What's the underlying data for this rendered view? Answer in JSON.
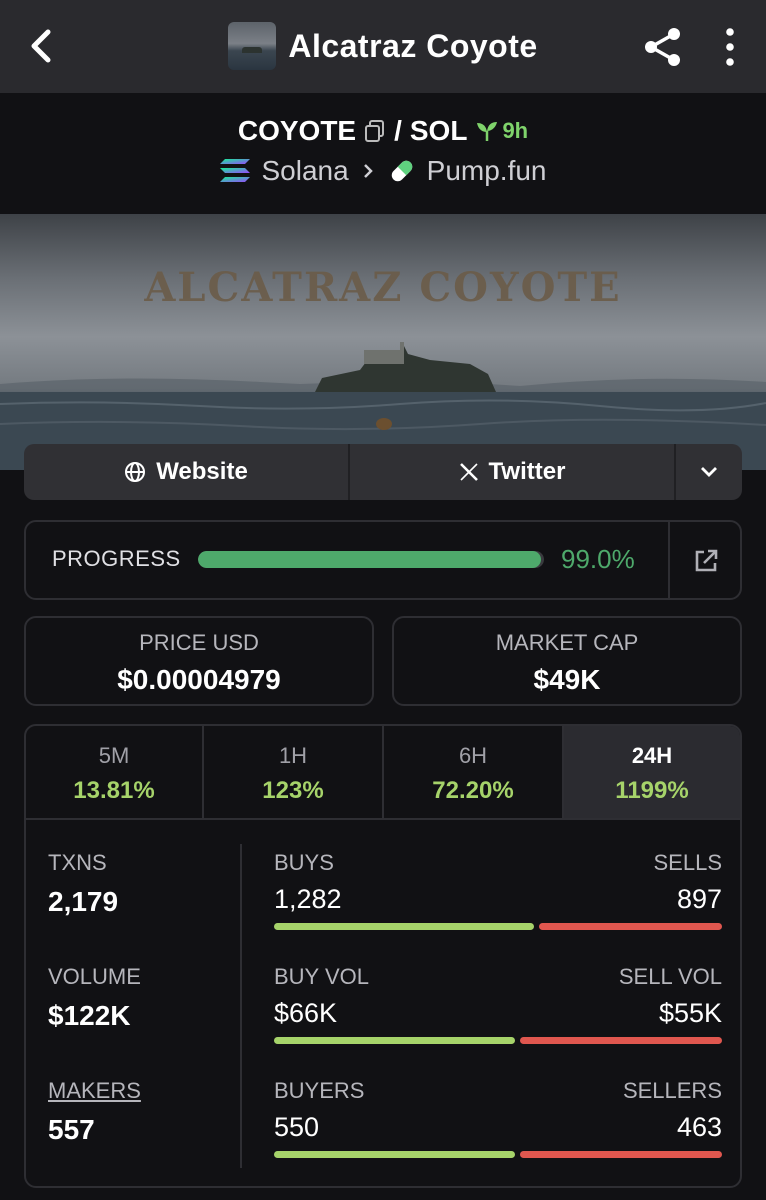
{
  "header": {
    "title": "Alcatraz Coyote"
  },
  "pair": {
    "base": "COYOTE",
    "separator": "/",
    "quote": "SOL",
    "age": "9h",
    "chain": "Solana",
    "dex": "Pump.fun"
  },
  "banner": {
    "title": "ALCATRAZ COYOTE"
  },
  "links": {
    "website": "Website",
    "twitter": "Twitter"
  },
  "progress": {
    "label": "PROGRESS",
    "value_text": "99.0%",
    "fraction": 0.99
  },
  "stats": {
    "price_label": "PRICE USD",
    "price_value": "$0.00004979",
    "mcap_label": "MARKET CAP",
    "mcap_value": "$49K"
  },
  "timeframes": [
    {
      "label": "5M",
      "value": "13.81%"
    },
    {
      "label": "1H",
      "value": "123%"
    },
    {
      "label": "6H",
      "value": "72.20%"
    },
    {
      "label": "24H",
      "value": "1199%",
      "active": true
    }
  ],
  "metrics": {
    "txns_label": "TXNS",
    "txns_value": "2,179",
    "volume_label": "VOLUME",
    "volume_value": "$122K",
    "makers_label": "MAKERS",
    "makers_value": "557"
  },
  "splits": {
    "buys_label": "BUYS",
    "sells_label": "SELLS",
    "buys_value": "1,282",
    "sells_value": "897",
    "buys_fraction": 0.588,
    "buyvol_label": "BUY VOL",
    "sellvol_label": "SELL VOL",
    "buyvol_value": "$66K",
    "sellvol_value": "$55K",
    "buyvol_fraction": 0.545,
    "buyers_label": "BUYERS",
    "sellers_label": "SELLERS",
    "buyers_value": "550",
    "sellers_value": "463",
    "buyers_fraction": 0.543
  },
  "colors": {
    "accent_green": "#4ea96b",
    "change_green": "#a6d36a",
    "sell_red": "#e0574f"
  }
}
